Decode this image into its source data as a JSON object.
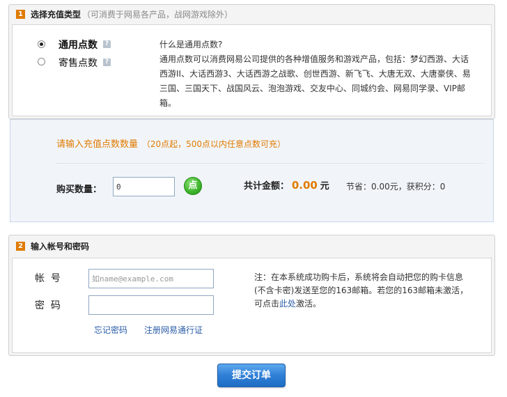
{
  "section1": {
    "number": "1",
    "title": "选择充值类型",
    "subtitle": "（可消费于网易各产品，战网游戏除外）",
    "options": [
      {
        "label": "通用点数",
        "selected": true
      },
      {
        "label": "寄售点数",
        "selected": false
      }
    ],
    "help_glyph": "?",
    "desc_title": "什么是通用点数?",
    "desc_lines": [
      "通用点数可以消费网易公司提供的各种增值服务和游戏产品，包括：梦幻西游、大话",
      "西游II、大话西游3、大话西游之战歌、创世西游、新飞飞、大唐无双、大唐豪侠、易",
      "三国、三国天下、战国风云、泡泡游戏、交友中心、同城约会、网易同学录、VIP邮",
      "箱。"
    ]
  },
  "recharge": {
    "prompt": "请输入充值点数数量",
    "hint": "（20点起，500点以内任意点数可充）",
    "qty_label": "购买数量：",
    "qty_value": "0",
    "unit_button": "点",
    "total_label": "共计金额：",
    "total_amount": "0.00",
    "total_unit": "元",
    "savings": "节省：0.00元，获积分：0"
  },
  "section2": {
    "number": "2",
    "title": "输入帐号和密码",
    "account_label": "帐  号",
    "account_placeholder": "如name@example.com",
    "password_label": "密  码",
    "forgot_link": "忘记密码",
    "register_link": "注册网易通行证",
    "note_line1": "注：在本系统成功购卡后，系统将会自动把您的购卡信息",
    "note_line2": "(不含卡密)发送至您的163邮箱。若您的163邮箱未激活，",
    "note_line3_prefix": "可点击",
    "note_line3_link": "此处",
    "note_line3_suffix": "激活。"
  },
  "submit_label": "提交订单",
  "colors": {
    "accent_orange": "#e07b00",
    "link_blue": "#2a5da8",
    "button_blue": "#2f7fd6",
    "button_green": "#3db52a"
  }
}
